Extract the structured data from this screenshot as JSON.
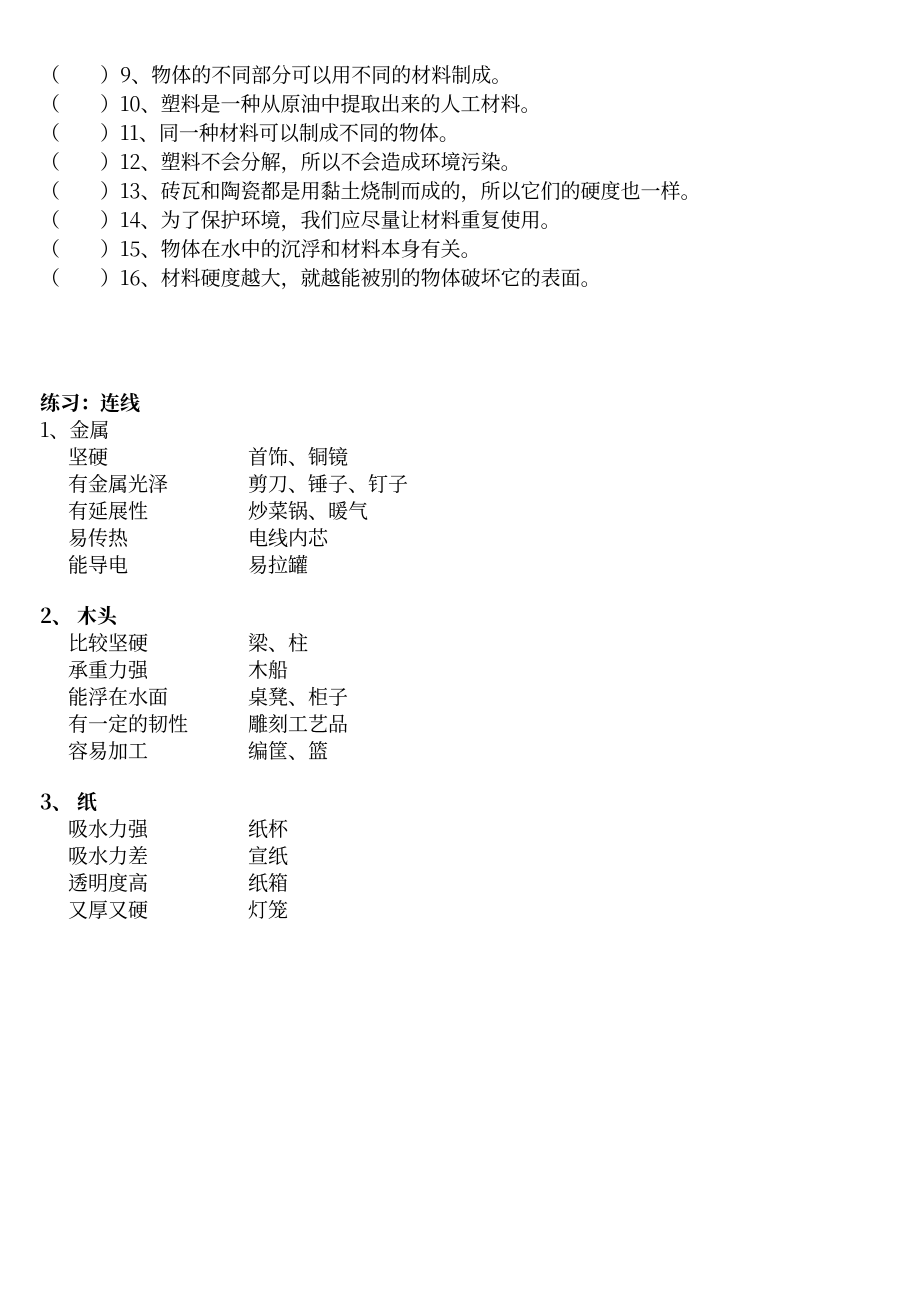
{
  "true_false": [
    {
      "num": "9",
      "text": "物体的不同部分可以用不同的材料制成。"
    },
    {
      "num": "10",
      "text": "塑料是一种从原油中提取出来的人工材料。"
    },
    {
      "num": "11",
      "text": "同一种材料可以制成不同的物体。"
    },
    {
      "num": "12",
      "text": "塑料不会分解，所以不会造成环境污染。"
    },
    {
      "num": "13",
      "text": "砖瓦和陶瓷都是用黏土烧制而成的，所以它们的硬度也一样。"
    },
    {
      "num": "14",
      "text": "为了保护环境，我们应尽量让材料重复使用。"
    },
    {
      "num": "15",
      "text": "物体在水中的沉浮和材料本身有关。"
    },
    {
      "num": "16",
      "text": "材料硬度越大，就越能被别的物体破坏它的表面。"
    }
  ],
  "section_title": "练习：连线",
  "groups": [
    {
      "head": "1、金属",
      "rows": [
        {
          "left": "坚硬",
          "right": "首饰、铜镜"
        },
        {
          "left": "有金属光泽",
          "right": "剪刀、锤子、钉子"
        },
        {
          "left": "有延展性",
          "right": "炒菜锅、暖气"
        },
        {
          "left": "易传热",
          "right": "电线内芯"
        },
        {
          "left": "能导电",
          "right": "易拉罐"
        }
      ]
    },
    {
      "head": "2、 木头",
      "rows": [
        {
          "left": "比较坚硬",
          "right": "梁、柱"
        },
        {
          "left": "承重力强",
          "right": "木船"
        },
        {
          "left": "能浮在水面",
          "right": "桌凳、柜子"
        },
        {
          "left": "有一定的韧性",
          "right": "雕刻工艺品"
        },
        {
          "left": "容易加工",
          "right": "编筐、篮"
        }
      ]
    },
    {
      "head": "3、  纸",
      "rows": [
        {
          "left": "吸水力强",
          "right": "纸杯"
        },
        {
          "left": "吸水力差",
          "right": "宣纸"
        },
        {
          "left": "透明度高",
          "right": "纸箱"
        },
        {
          "left": "又厚又硬",
          "right": "灯笼"
        }
      ]
    }
  ],
  "paren_open": "（",
  "paren_close": "）",
  "num_sep": "、"
}
